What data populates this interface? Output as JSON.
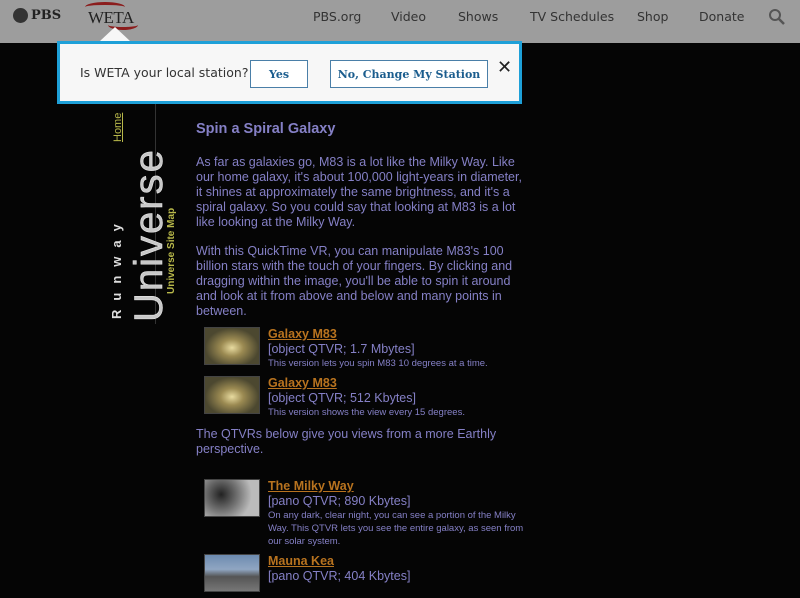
{
  "header": {
    "pbs_logo": "PBS",
    "weta_logo": "WETA",
    "nav": [
      "PBS.org",
      "Video",
      "Shows",
      "TV Schedules",
      "Shop",
      "Donate"
    ],
    "search_icon": "search-icon"
  },
  "popup": {
    "question": "Is WETA your local station?",
    "yes": "Yes",
    "no": "No, Change My Station",
    "close": "✕"
  },
  "sidebar": {
    "runway": "Runway",
    "universe": "Universe",
    "home": "Home",
    "sitemap": "Universe Site Map"
  },
  "content": {
    "title": "Spin a Spiral Galaxy",
    "p1": "As far as galaxies go, M83 is a lot like the Milky Way. Like our home galaxy, it's about 100,000 light-years in diameter, it shines at approximately the same brightness, and it's a spiral galaxy. So you could say that looking at M83 is a lot like looking at the Milky Way.",
    "p2": "With this QuickTime VR, you can manipulate M83's 100 billion stars with the touch of your fingers. By clicking and dragging within the image, you'll be able to spin it around and look at it from above and below and many points in between.",
    "items1": [
      {
        "title": "Galaxy M83",
        "meta": "[object QTVR; 1.7 Mbytes]",
        "desc": "This version lets you spin M83 10 degrees at a time."
      },
      {
        "title": "Galaxy M83",
        "meta": "[object QTVR; 512 Kbytes]",
        "desc": "This version shows the view every 15 degrees."
      }
    ],
    "p3": "The QTVRs below give you views from a more Earthly perspective.",
    "items2": [
      {
        "title": "The Milky Way",
        "meta": "[pano QTVR; 890 Kbytes]",
        "desc": "On any dark, clear night, you can see a portion of the Milky Way. This QTVR lets you see the entire galaxy, as seen from our solar system."
      },
      {
        "title": "Mauna Kea",
        "meta": "[pano QTVR; 404 Kbytes]",
        "desc": ""
      }
    ]
  }
}
